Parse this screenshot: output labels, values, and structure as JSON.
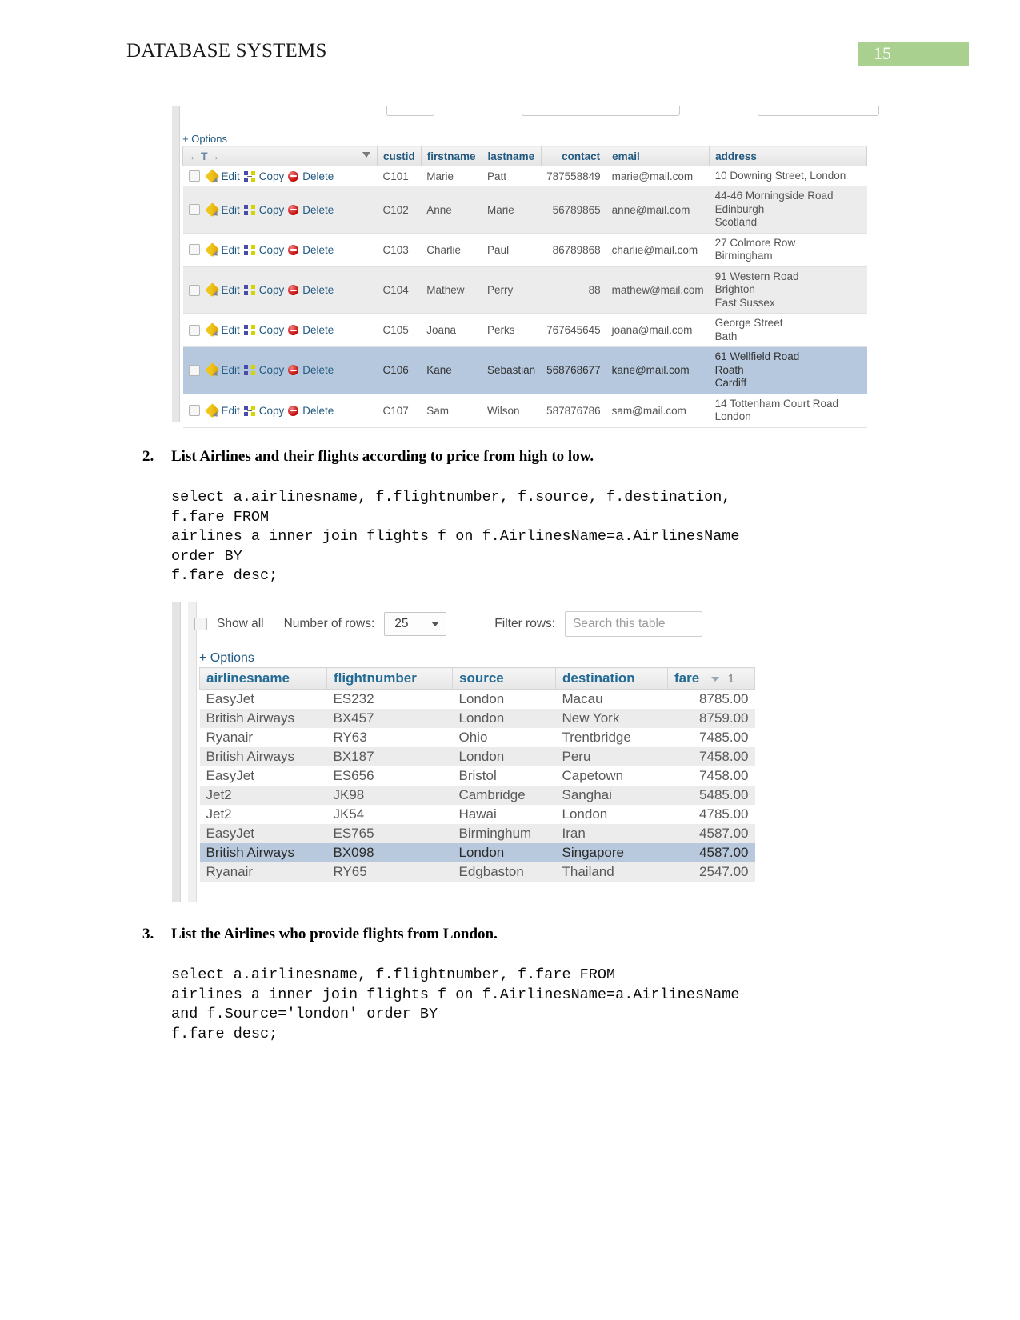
{
  "header": {
    "title": "DATABASE SYSTEMS",
    "page_number": "15",
    "accent_color": "#a9d08e"
  },
  "customers_panel": {
    "options_label": "+ Options",
    "nav_arrows": "←T→",
    "columns": [
      "custid",
      "firstname",
      "lastname",
      "contact",
      "email",
      "address"
    ],
    "row_actions": {
      "edit": "Edit",
      "copy": "Copy",
      "delete": "Delete"
    },
    "rows": [
      {
        "custid": "C101",
        "firstname": "Marie",
        "lastname": "Patt",
        "contact": "787558849",
        "email": "marie@mail.com",
        "address": "10 Downing Street, London",
        "state": "odd"
      },
      {
        "custid": "C102",
        "firstname": "Anne",
        "lastname": "Marie",
        "contact": "56789865",
        "email": "anne@mail.com",
        "address": "44-46 Morningside Road\nEdinburgh\nScotland",
        "state": "even"
      },
      {
        "custid": "C103",
        "firstname": "Charlie",
        "lastname": "Paul",
        "contact": "86789868",
        "email": "charlie@mail.com",
        "address": "27 Colmore Row\nBirmingham",
        "state": "odd"
      },
      {
        "custid": "C104",
        "firstname": "Mathew",
        "lastname": "Perry",
        "contact": "88",
        "email": "mathew@mail.com",
        "address": "91 Western Road\nBrighton\nEast Sussex",
        "state": "even"
      },
      {
        "custid": "C105",
        "firstname": "Joana",
        "lastname": "Perks",
        "contact": "767645645",
        "email": "joana@mail.com",
        "address": "George Street\nBath",
        "state": "odd"
      },
      {
        "custid": "C106",
        "firstname": "Kane",
        "lastname": "Sebastian",
        "contact": "568768677",
        "email": "kane@mail.com",
        "address": "61 Wellfield Road\nRoath\nCardiff",
        "state": "marked"
      },
      {
        "custid": "C107",
        "firstname": "Sam",
        "lastname": "Wilson",
        "contact": "587876786",
        "email": "sam@mail.com",
        "address": "14 Tottenham Court Road\nLondon",
        "state": "odd"
      }
    ]
  },
  "question2": {
    "number": "2.",
    "text": "List Airlines and their flights according to price from high to low.",
    "sql": "select a.airlinesname, f.flightnumber, f.source, f.destination,\nf.fare FROM\nairlines a inner join flights f on f.AirlinesName=a.AirlinesName\norder BY\nf.fare desc;"
  },
  "flights_panel": {
    "toolbar": {
      "show_all_label": "Show all",
      "number_of_rows_label": "Number of rows:",
      "rows_value": "25",
      "filter_rows_label": "Filter rows:",
      "search_placeholder": "Search this table"
    },
    "options_label": "+ Options",
    "columns": [
      "airlinesname",
      "flightnumber",
      "source",
      "destination",
      "fare"
    ],
    "sort_index": "1",
    "rows": [
      {
        "airlinesname": "EasyJet",
        "flightnumber": "ES232",
        "source": "London",
        "destination": "Macau",
        "fare": "8785.00",
        "state": "odd"
      },
      {
        "airlinesname": "British Airways",
        "flightnumber": "BX457",
        "source": "London",
        "destination": "New York",
        "fare": "8759.00",
        "state": "even"
      },
      {
        "airlinesname": "Ryanair",
        "flightnumber": "RY63",
        "source": "Ohio",
        "destination": "Trentbridge",
        "fare": "7485.00",
        "state": "odd"
      },
      {
        "airlinesname": "British Airways",
        "flightnumber": "BX187",
        "source": "London",
        "destination": "Peru",
        "fare": "7458.00",
        "state": "even"
      },
      {
        "airlinesname": "EasyJet",
        "flightnumber": "ES656",
        "source": "Bristol",
        "destination": "Capetown",
        "fare": "7458.00",
        "state": "odd"
      },
      {
        "airlinesname": "Jet2",
        "flightnumber": "JK98",
        "source": "Cambridge",
        "destination": "Sanghai",
        "fare": "5485.00",
        "state": "even"
      },
      {
        "airlinesname": "Jet2",
        "flightnumber": "JK54",
        "source": "Hawai",
        "destination": "London",
        "fare": "4785.00",
        "state": "odd"
      },
      {
        "airlinesname": "EasyJet",
        "flightnumber": "ES765",
        "source": "Birminghum",
        "destination": "Iran",
        "fare": "4587.00",
        "state": "even"
      },
      {
        "airlinesname": "British Airways",
        "flightnumber": "BX098",
        "source": "London",
        "destination": "Singapore",
        "fare": "4587.00",
        "state": "marked"
      },
      {
        "airlinesname": "Ryanair",
        "flightnumber": "RY65",
        "source": "Edgbaston",
        "destination": "Thailand",
        "fare": "2547.00",
        "state": "even"
      }
    ]
  },
  "question3": {
    "number": "3.",
    "text": "List the Airlines who provide flights from London.",
    "sql": "select a.airlinesname, f.flightnumber, f.fare FROM\nairlines a inner join flights f on f.AirlinesName=a.AirlinesName\nand f.Source='london' order BY\nf.fare desc;"
  }
}
